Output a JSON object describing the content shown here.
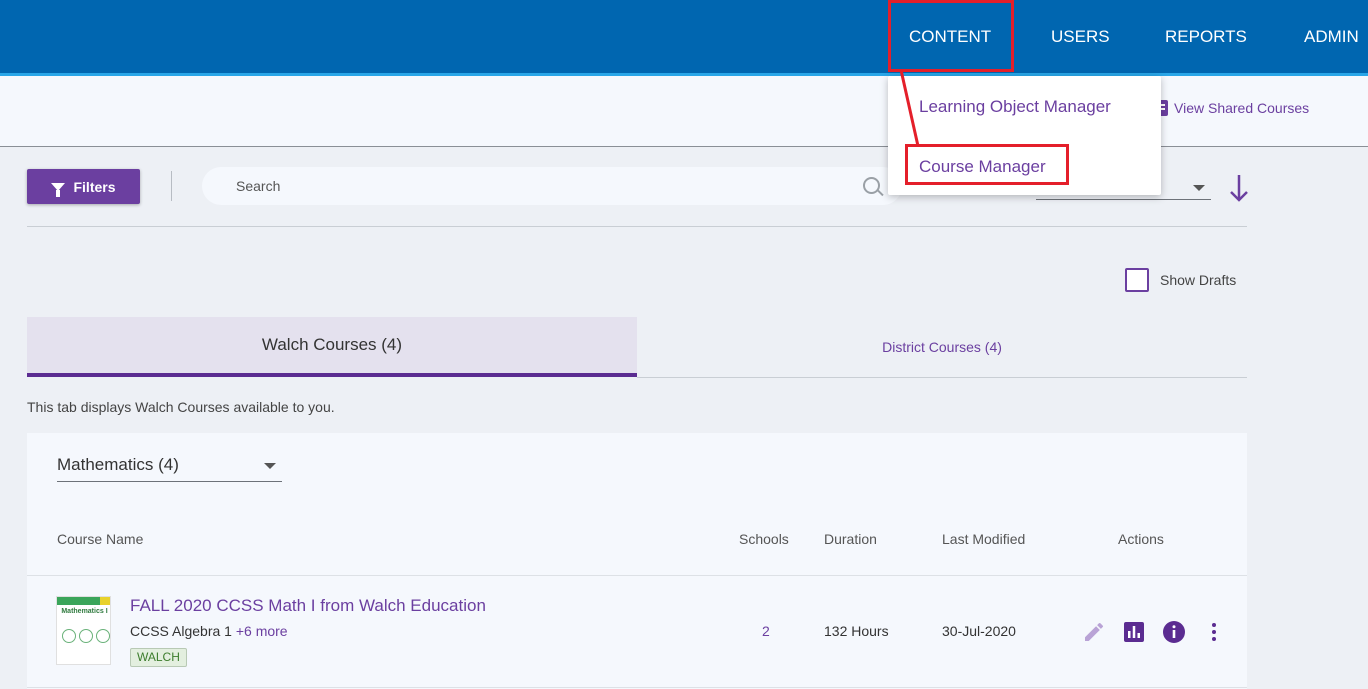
{
  "nav": {
    "items": [
      {
        "label": "CONTENT"
      },
      {
        "label": "USERS"
      },
      {
        "label": "REPORTS"
      },
      {
        "label": "ADMIN"
      }
    ]
  },
  "dropdown": {
    "items": [
      {
        "label": "Learning Object Manager"
      },
      {
        "label": "Course Manager"
      }
    ]
  },
  "toolbar": {
    "shared_courses_label": "View Shared Courses",
    "filters_label": "Filters",
    "search_placeholder": "Search",
    "show_drafts_label": "Show Drafts"
  },
  "tabs": [
    {
      "label": "Walch Courses (4)",
      "active": true
    },
    {
      "label": "District Courses (4)",
      "active": false
    }
  ],
  "tab_description": "This tab displays Walch Courses available to you.",
  "subject_filter": {
    "selected": "Mathematics (4)"
  },
  "table": {
    "columns": [
      "Course Name",
      "Schools",
      "Duration",
      "Last Modified",
      "Actions"
    ],
    "rows": [
      {
        "title": "FALL 2020 CCSS Math I from Walch Education",
        "subtitle": "CCSS Algebra 1",
        "more": "+6 more",
        "badge": "WALCH",
        "schools": "2",
        "duration": "132 Hours",
        "last_modified": "30-Jul-2020",
        "thumbnail_text": "Mathematics I"
      }
    ]
  },
  "colors": {
    "topbar": "#0066b0",
    "accent": "#6b3fa0",
    "highlight": "#e41f2a"
  }
}
